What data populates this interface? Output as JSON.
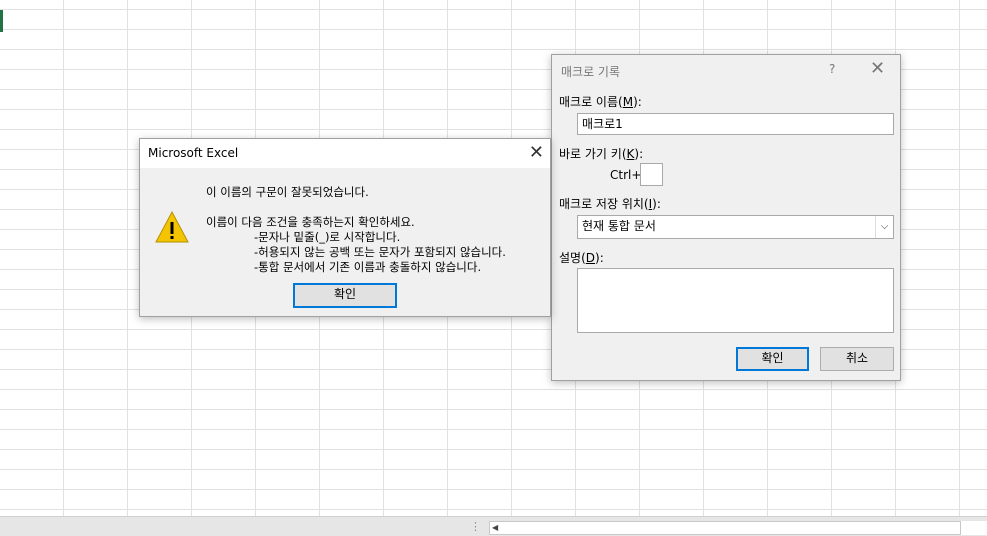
{
  "error_dialog": {
    "title": "Microsoft Excel",
    "line1": "이 이름의 구문이 잘못되었습니다.",
    "line2": "이름이 다음 조건을 충족하는지 확인하세요.",
    "bullet1": "-문자나 밑줄(_)로 시작합니다.",
    "bullet2": "-허용되지 않는 공백 또는 문자가 포함되지 않습니다.",
    "bullet3": "-통합 문서에서 기존 이름과 충돌하지 않습니다.",
    "ok_label": "확인",
    "icon": "warning-icon"
  },
  "macro_dialog": {
    "title": "매크로 기록",
    "help": "?",
    "name_label_pre": "매크로 이름(",
    "name_label_key": "M",
    "name_label_post": "):",
    "name_value": "매크로1",
    "shortcut_label_pre": "바로 가기 키(",
    "shortcut_label_key": "K",
    "shortcut_label_post": "):",
    "ctrl_label": "Ctrl+",
    "shortcut_value": "",
    "store_label_pre": "매크로 저장 위치(",
    "store_label_key": "I",
    "store_label_post": "):",
    "store_value": "현재 통합 문서",
    "desc_label_pre": "설명(",
    "desc_label_key": "D",
    "desc_label_post": "):",
    "desc_value": "",
    "ok_label": "확인",
    "cancel_label": "취소"
  },
  "statusbar": {
    "dots": "⋮"
  },
  "colors": {
    "selection": "#217346",
    "focus": "#0078d7",
    "warning": "#f5c400"
  }
}
